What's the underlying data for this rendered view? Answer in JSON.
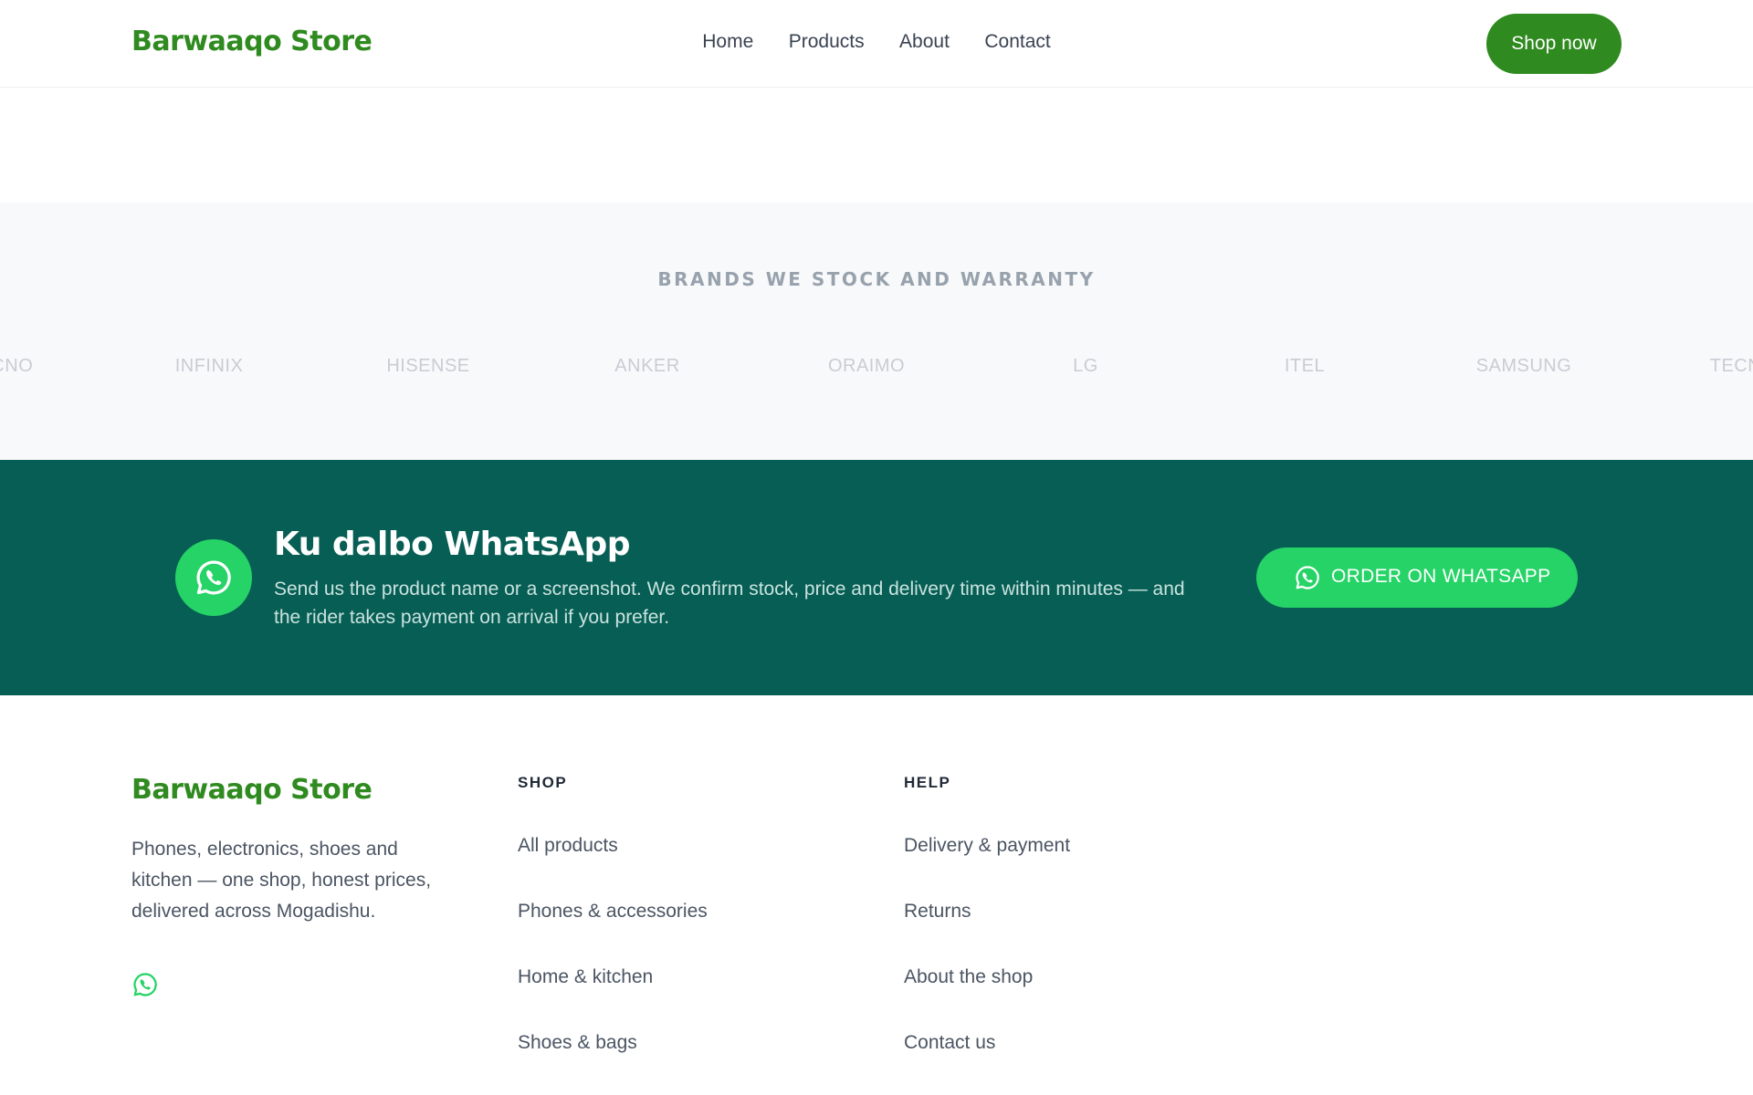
{
  "header": {
    "logo": "Barwaaqo Store",
    "nav": [
      "Home",
      "Products",
      "About",
      "Contact"
    ],
    "cta": "Shop now"
  },
  "brands": {
    "title": "BRANDS WE STOCK AND WARRANTY",
    "items": [
      "TECNO",
      "INFINIX",
      "HISENSE",
      "ANKER",
      "ORAIMO",
      "LG",
      "ITEL",
      "SAMSUNG",
      "TECNO"
    ]
  },
  "whatsapp": {
    "title": "Ku dalbo WhatsApp",
    "text": "Send us the product name or a screenshot. We confirm stock, price and delivery time within minutes — and the rider takes payment on arrival if you prefer.",
    "button": "ORDER ON WHATSAPP"
  },
  "footer": {
    "logo": "Barwaaqo Store",
    "description": "Phones, electronics, shoes and kitchen — one shop, honest prices, delivered across Mogadishu.",
    "shop": {
      "heading": "SHOP",
      "links": [
        "All products",
        "Phones & accessories",
        "Home & kitchen",
        "Shoes & bags"
      ]
    },
    "help": {
      "heading": "HELP",
      "links": [
        "Delivery & payment",
        "Returns",
        "About the shop",
        "Contact us"
      ]
    }
  },
  "colors": {
    "brand_green": "#2f8a1f",
    "whatsapp_green": "#25d366",
    "whatsapp_band": "#075e54"
  },
  "icons": [
    "whatsapp-icon"
  ]
}
